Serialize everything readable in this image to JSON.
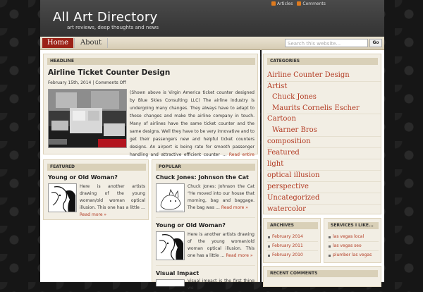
{
  "header": {
    "site_title": "All Art Directory",
    "site_description": "art reviews, deep thoughts and news",
    "feed_articles": "Articles",
    "feed_comments": "Comments"
  },
  "nav": {
    "home": "Home",
    "about": "About",
    "search_placeholder": "Search this website...",
    "go": "Go"
  },
  "headline": {
    "label": "HEADLINE",
    "title": "Airline Ticket Counter Design",
    "meta": "February 15th, 2014 | Comments Off",
    "excerpt": "(Shown above is Virgin America ticket counter designed by Blue Skies Consulting LLC) The airline industry is undergoing many changes. They always have to adapt to those changes and make the airline company in touch. Many of airlines have the same ticket counter and the same designs. Well they have to be very innovative and to get their passengers new and helpful ticket counters designs. An airport is being rate for smooth passenger handling and attractive efficient counter …",
    "more": "Read entire article »"
  },
  "featured": {
    "label": "FEATURED",
    "title": "Young or Old Woman?",
    "excerpt": "Here is another artists drawing of the young woman/old woman optical illusion. This one has a little …",
    "more": "Read more »"
  },
  "popular": {
    "label": "POPULAR",
    "items": [
      {
        "title": "Chuck Jones: Johnson the Cat",
        "excerpt": "Chuck Jones: Johnson the Cat “He moved into our house that morning, bag and baggage. The bag was …",
        "more": "Read more »"
      },
      {
        "title": "Young or Old Woman?",
        "excerpt": "Here is another artists drawing of the young woman/old woman optical illusion. This one has a little …",
        "more": "Read more »"
      },
      {
        "title": "Visual Impact",
        "excerpt": "Visual impact is the first thing we"
      }
    ]
  },
  "categories": {
    "label": "CATEGORIES",
    "items": [
      "Airline Counter Design",
      "Artist",
      "Chuck Jones",
      "Maurits Cornelis Escher",
      "Cartoon",
      "Warner Bros",
      "composition",
      "Featured",
      "light",
      "optical illusion",
      "perspective",
      "Uncategorized",
      "watercolor"
    ]
  },
  "archives": {
    "label": "ARCHIVES",
    "items": [
      "February 2014",
      "February 2011",
      "February 2010"
    ]
  },
  "services": {
    "label": "SERVICES I LIKE...",
    "items": [
      "las vegas local",
      "las vegas seo",
      "plumber las vegas"
    ]
  },
  "recent_comments": {
    "label": "RECENT COMMENTS"
  }
}
